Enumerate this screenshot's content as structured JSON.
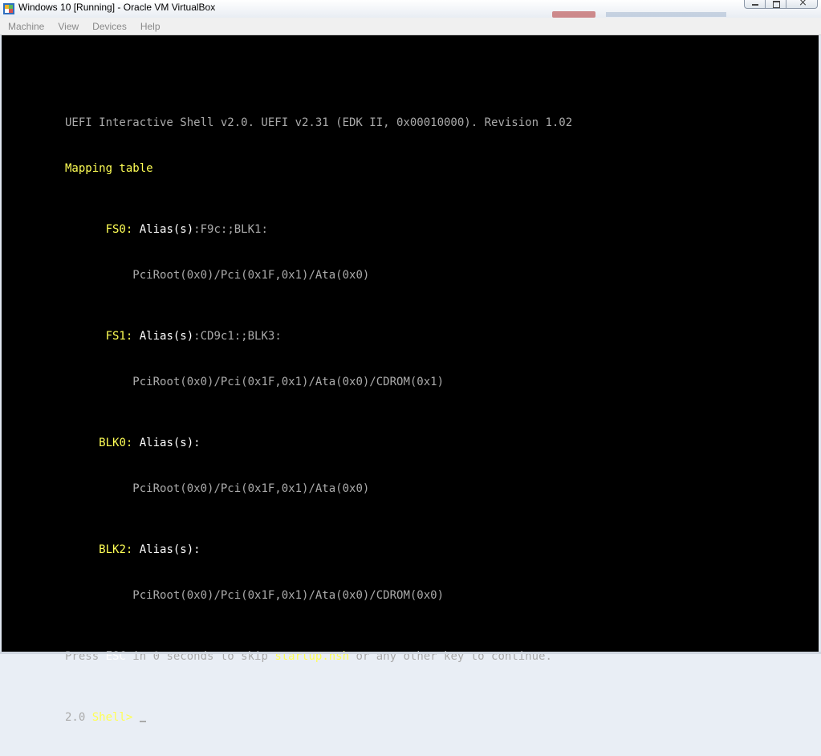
{
  "window": {
    "title": "Windows 10 [Running] - Oracle VM VirtualBox",
    "icon": "virtualbox-icon",
    "controls": [
      "minimize-icon",
      "maximize-icon",
      "close-icon"
    ]
  },
  "menubar": {
    "items": [
      "Machine",
      "View",
      "Devices",
      "Help"
    ]
  },
  "terminal": {
    "header": "UEFI Interactive Shell v2.0. UEFI v2.31 (EDK II, 0x00010000). Revision 1.02",
    "mapping_title": "Mapping table",
    "entries": [
      {
        "name": "FS0",
        "alias_label": "Alias(s)",
        "alias_value": ":F9c:;BLK1:",
        "path": "PciRoot(0x0)/Pci(0x1F,0x1)/Ata(0x0)"
      },
      {
        "name": "FS1",
        "alias_label": "Alias(s)",
        "alias_value": ":CD9c1:;BLK3:",
        "path": "PciRoot(0x0)/Pci(0x1F,0x1)/Ata(0x0)/CDROM(0x1)"
      },
      {
        "name": "BLK0",
        "alias_label": "Alias(s)",
        "alias_value": ":",
        "path": "PciRoot(0x0)/Pci(0x1F,0x1)/Ata(0x0)"
      },
      {
        "name": "BLK2",
        "alias_label": "Alias(s)",
        "alias_value": ":",
        "path": "PciRoot(0x0)/Pci(0x1F,0x1)/Ata(0x0)/CDROM(0x0)"
      }
    ],
    "press_line": {
      "p1": "Press ",
      "esc": "ESC",
      "p2": " in 0 seconds to skip ",
      "file": "startup.nsh",
      "p3": " or any other key to continue."
    },
    "prompt": {
      "version": "2.0 ",
      "label": "Shell> "
    }
  },
  "colors": {
    "terminal_bg": "#000000",
    "text_gray": "#aaaaaa",
    "text_yellow": "#ffff55",
    "text_white": "#ffffff"
  }
}
